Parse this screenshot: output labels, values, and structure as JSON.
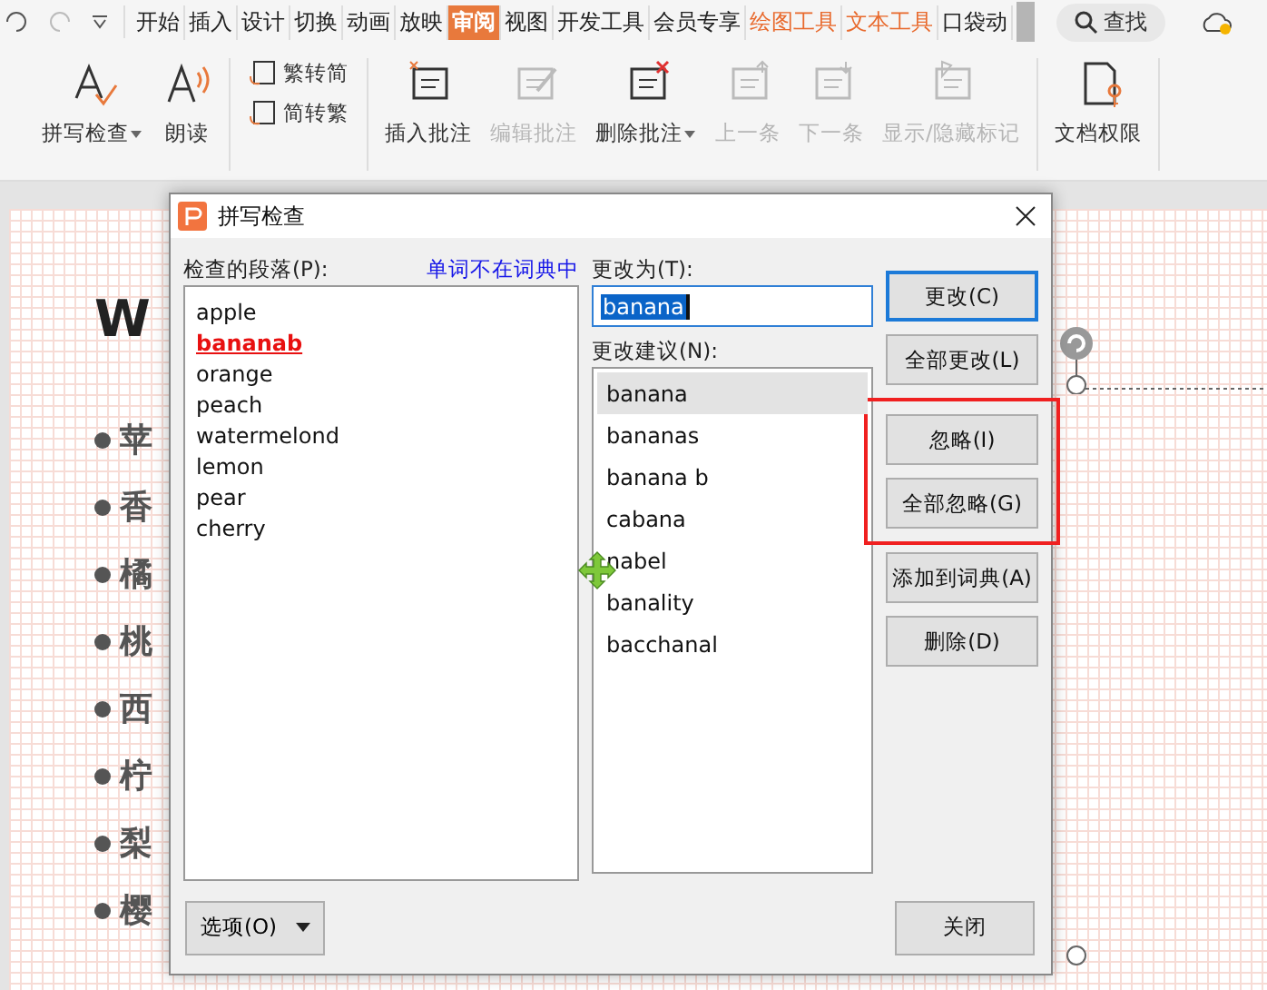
{
  "menu_tabs": [
    {
      "label": "开始",
      "selected": false,
      "kind": "normal"
    },
    {
      "label": "插入",
      "selected": false,
      "kind": "normal"
    },
    {
      "label": "设计",
      "selected": false,
      "kind": "normal"
    },
    {
      "label": "切换",
      "selected": false,
      "kind": "normal"
    },
    {
      "label": "动画",
      "selected": false,
      "kind": "normal"
    },
    {
      "label": "放映",
      "selected": false,
      "kind": "normal"
    },
    {
      "label": "审阅",
      "selected": true,
      "kind": "normal"
    },
    {
      "label": "视图",
      "selected": false,
      "kind": "normal"
    },
    {
      "label": "开发工具",
      "selected": false,
      "kind": "normal"
    },
    {
      "label": "会员专享",
      "selected": false,
      "kind": "normal"
    },
    {
      "label": "绘图工具",
      "selected": false,
      "kind": "contextual"
    },
    {
      "label": "文本工具",
      "selected": false,
      "kind": "contextual"
    },
    {
      "label": "口袋动",
      "selected": false,
      "kind": "normal"
    }
  ],
  "search": {
    "label": "查找"
  },
  "ribbon": [
    {
      "kind": "large",
      "label": "拼写检查",
      "dropdown": true,
      "disabled": false
    },
    {
      "kind": "large",
      "label": "朗读",
      "dropdown": false,
      "disabled": false
    },
    {
      "kind": "pair",
      "items": [
        {
          "label": "繁转简"
        },
        {
          "label": "简转繁"
        }
      ]
    },
    {
      "kind": "large",
      "label": "插入批注",
      "dropdown": false,
      "disabled": false
    },
    {
      "kind": "large",
      "label": "编辑批注",
      "dropdown": false,
      "disabled": true
    },
    {
      "kind": "large",
      "label": "删除批注",
      "dropdown": true,
      "disabled": false
    },
    {
      "kind": "large",
      "label": "上一条",
      "dropdown": false,
      "disabled": true
    },
    {
      "kind": "large",
      "label": "下一条",
      "dropdown": false,
      "disabled": true
    },
    {
      "kind": "large",
      "label": "显示/隐藏标记",
      "dropdown": false,
      "disabled": true
    },
    {
      "kind": "large",
      "label": "文档权限",
      "dropdown": false,
      "disabled": false
    }
  ],
  "slide": {
    "title": "W",
    "bullets": [
      "苹",
      "香",
      "橘",
      "桃",
      "西",
      "柠",
      "梨",
      "樱"
    ]
  },
  "dialog": {
    "title": "拼写检查",
    "paragraph_label": "检查的段落(P):",
    "status": "单词不在词典中",
    "paragraph_words": [
      {
        "text": "apple",
        "misspelled": false
      },
      {
        "text": "bananab",
        "misspelled": true
      },
      {
        "text": "orange",
        "misspelled": false
      },
      {
        "text": "peach",
        "misspelled": false
      },
      {
        "text": "watermelond",
        "misspelled": false
      },
      {
        "text": "lemon",
        "misspelled": false
      },
      {
        "text": "pear",
        "misspelled": false
      },
      {
        "text": "cherry",
        "misspelled": false
      }
    ],
    "change_to_label": "更改为(T):",
    "change_to": "banana",
    "suggestions_label": "更改建议(N):",
    "suggestions": [
      {
        "text": "banana",
        "selected": true
      },
      {
        "text": "bananas",
        "selected": false
      },
      {
        "text": "banana b",
        "selected": false
      },
      {
        "text": "cabana",
        "selected": false
      },
      {
        "text": "nabel",
        "selected": false
      },
      {
        "text": "banality",
        "selected": false
      },
      {
        "text": "bacchanal",
        "selected": false
      }
    ],
    "button_groups": [
      {
        "kind": "plain",
        "buttons": [
          {
            "label": "更改(C)",
            "focused": true
          },
          {
            "label": "全部更改(L)",
            "focused": false
          }
        ]
      },
      {
        "kind": "highlighted",
        "buttons": [
          {
            "label": "忽略(I)",
            "focused": false
          },
          {
            "label": "全部忽略(G)",
            "focused": false
          }
        ]
      },
      {
        "kind": "plain",
        "buttons": [
          {
            "label": "添加到词典(A)",
            "focused": false
          },
          {
            "label": "删除(D)",
            "focused": false
          }
        ]
      }
    ],
    "options_button": "选项(O)",
    "close_button": "关闭"
  }
}
